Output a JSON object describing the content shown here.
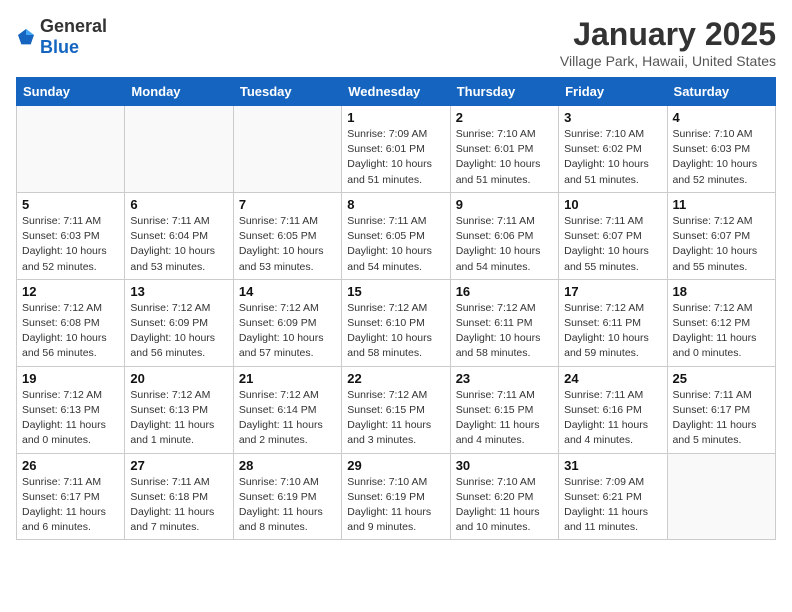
{
  "header": {
    "logo_general": "General",
    "logo_blue": "Blue",
    "month": "January 2025",
    "location": "Village Park, Hawaii, United States"
  },
  "weekdays": [
    "Sunday",
    "Monday",
    "Tuesday",
    "Wednesday",
    "Thursday",
    "Friday",
    "Saturday"
  ],
  "weeks": [
    [
      {
        "day": "",
        "info": ""
      },
      {
        "day": "",
        "info": ""
      },
      {
        "day": "",
        "info": ""
      },
      {
        "day": "1",
        "info": "Sunrise: 7:09 AM\nSunset: 6:01 PM\nDaylight: 10 hours\nand 51 minutes."
      },
      {
        "day": "2",
        "info": "Sunrise: 7:10 AM\nSunset: 6:01 PM\nDaylight: 10 hours\nand 51 minutes."
      },
      {
        "day": "3",
        "info": "Sunrise: 7:10 AM\nSunset: 6:02 PM\nDaylight: 10 hours\nand 51 minutes."
      },
      {
        "day": "4",
        "info": "Sunrise: 7:10 AM\nSunset: 6:03 PM\nDaylight: 10 hours\nand 52 minutes."
      }
    ],
    [
      {
        "day": "5",
        "info": "Sunrise: 7:11 AM\nSunset: 6:03 PM\nDaylight: 10 hours\nand 52 minutes."
      },
      {
        "day": "6",
        "info": "Sunrise: 7:11 AM\nSunset: 6:04 PM\nDaylight: 10 hours\nand 53 minutes."
      },
      {
        "day": "7",
        "info": "Sunrise: 7:11 AM\nSunset: 6:05 PM\nDaylight: 10 hours\nand 53 minutes."
      },
      {
        "day": "8",
        "info": "Sunrise: 7:11 AM\nSunset: 6:05 PM\nDaylight: 10 hours\nand 54 minutes."
      },
      {
        "day": "9",
        "info": "Sunrise: 7:11 AM\nSunset: 6:06 PM\nDaylight: 10 hours\nand 54 minutes."
      },
      {
        "day": "10",
        "info": "Sunrise: 7:11 AM\nSunset: 6:07 PM\nDaylight: 10 hours\nand 55 minutes."
      },
      {
        "day": "11",
        "info": "Sunrise: 7:12 AM\nSunset: 6:07 PM\nDaylight: 10 hours\nand 55 minutes."
      }
    ],
    [
      {
        "day": "12",
        "info": "Sunrise: 7:12 AM\nSunset: 6:08 PM\nDaylight: 10 hours\nand 56 minutes."
      },
      {
        "day": "13",
        "info": "Sunrise: 7:12 AM\nSunset: 6:09 PM\nDaylight: 10 hours\nand 56 minutes."
      },
      {
        "day": "14",
        "info": "Sunrise: 7:12 AM\nSunset: 6:09 PM\nDaylight: 10 hours\nand 57 minutes."
      },
      {
        "day": "15",
        "info": "Sunrise: 7:12 AM\nSunset: 6:10 PM\nDaylight: 10 hours\nand 58 minutes."
      },
      {
        "day": "16",
        "info": "Sunrise: 7:12 AM\nSunset: 6:11 PM\nDaylight: 10 hours\nand 58 minutes."
      },
      {
        "day": "17",
        "info": "Sunrise: 7:12 AM\nSunset: 6:11 PM\nDaylight: 10 hours\nand 59 minutes."
      },
      {
        "day": "18",
        "info": "Sunrise: 7:12 AM\nSunset: 6:12 PM\nDaylight: 11 hours\nand 0 minutes."
      }
    ],
    [
      {
        "day": "19",
        "info": "Sunrise: 7:12 AM\nSunset: 6:13 PM\nDaylight: 11 hours\nand 0 minutes."
      },
      {
        "day": "20",
        "info": "Sunrise: 7:12 AM\nSunset: 6:13 PM\nDaylight: 11 hours\nand 1 minute."
      },
      {
        "day": "21",
        "info": "Sunrise: 7:12 AM\nSunset: 6:14 PM\nDaylight: 11 hours\nand 2 minutes."
      },
      {
        "day": "22",
        "info": "Sunrise: 7:12 AM\nSunset: 6:15 PM\nDaylight: 11 hours\nand 3 minutes."
      },
      {
        "day": "23",
        "info": "Sunrise: 7:11 AM\nSunset: 6:15 PM\nDaylight: 11 hours\nand 4 minutes."
      },
      {
        "day": "24",
        "info": "Sunrise: 7:11 AM\nSunset: 6:16 PM\nDaylight: 11 hours\nand 4 minutes."
      },
      {
        "day": "25",
        "info": "Sunrise: 7:11 AM\nSunset: 6:17 PM\nDaylight: 11 hours\nand 5 minutes."
      }
    ],
    [
      {
        "day": "26",
        "info": "Sunrise: 7:11 AM\nSunset: 6:17 PM\nDaylight: 11 hours\nand 6 minutes."
      },
      {
        "day": "27",
        "info": "Sunrise: 7:11 AM\nSunset: 6:18 PM\nDaylight: 11 hours\nand 7 minutes."
      },
      {
        "day": "28",
        "info": "Sunrise: 7:10 AM\nSunset: 6:19 PM\nDaylight: 11 hours\nand 8 minutes."
      },
      {
        "day": "29",
        "info": "Sunrise: 7:10 AM\nSunset: 6:19 PM\nDaylight: 11 hours\nand 9 minutes."
      },
      {
        "day": "30",
        "info": "Sunrise: 7:10 AM\nSunset: 6:20 PM\nDaylight: 11 hours\nand 10 minutes."
      },
      {
        "day": "31",
        "info": "Sunrise: 7:09 AM\nSunset: 6:21 PM\nDaylight: 11 hours\nand 11 minutes."
      },
      {
        "day": "",
        "info": ""
      }
    ]
  ]
}
